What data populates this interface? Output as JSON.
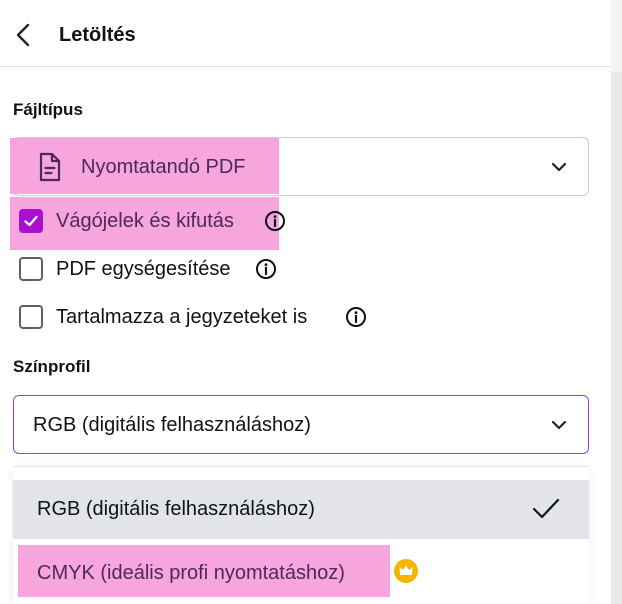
{
  "header": {
    "title": "Letöltés",
    "back_icon": "chevron-left-icon"
  },
  "file_type": {
    "label": "Fájltípus",
    "value": "Nyomtatandó PDF",
    "icon": "document-icon"
  },
  "options": [
    {
      "label": "Vágójelek és kifutás",
      "checked": true,
      "has_info": true
    },
    {
      "label": "PDF egységesítése",
      "checked": false,
      "has_info": true
    },
    {
      "label": "Tartalmazza a jegyzeteket is",
      "checked": false,
      "has_info": true
    }
  ],
  "color_profile": {
    "label": "Színprofil",
    "value": "RGB (digitális felhasználáshoz)",
    "menu": [
      {
        "label": "RGB (digitális felhasználáshoz)",
        "selected": true,
        "icon": "checkmark-icon"
      },
      {
        "label": "CMYK (ideális profi nyomtatáshoz)",
        "selected": false,
        "icon": "crown-icon"
      }
    ]
  },
  "colors": {
    "highlight": "#f59bd9",
    "checkbox_accent": "#a80fd1",
    "crown": "#f5b400"
  }
}
